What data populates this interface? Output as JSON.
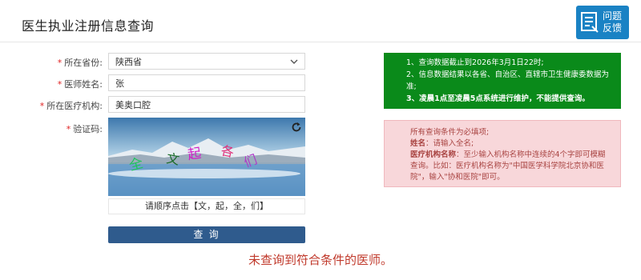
{
  "page": {
    "title": "医生执业注册信息查询"
  },
  "feedback": {
    "line1": "问题",
    "line2": "反馈"
  },
  "form": {
    "province": {
      "label": "所在省份:",
      "value": "陕西省"
    },
    "name": {
      "label": "医师姓名:",
      "value": "张"
    },
    "institution": {
      "label": "所在医疗机构:",
      "value": "美奥口腔"
    },
    "captcha": {
      "label": "验证码:",
      "chars": [
        "全",
        "文",
        "起",
        "各",
        "们"
      ],
      "hint": "请顺序点击【文，起，全，们】"
    },
    "submit": "查 询"
  },
  "notice_green": [
    "1、查询数据截止到2026年3月1日22时;",
    "2、信息数据结果以各省、自治区、直辖市卫生健康委数据为准;",
    "3、凌晨1点至凌晨5点系统进行维护，不能提供查询。"
  ],
  "notice_red": {
    "line1": "所有查询条件为必填项;",
    "name_label": "姓名",
    "name_text": "：请输入全名;",
    "inst_label": "医疗机构名称",
    "inst_text": "：至少输入机构名称中连续的4个字即可模糊查询。比如：医疗机构名称为\"中国医学科学院北京协和医院\"，输入\"协和医院\"即可。"
  },
  "result": "未查询到符合条件的医师。",
  "colors": {
    "accent_blue": "#2f5b8d",
    "notice_green": "#0a8a1a",
    "notice_red_bg": "#f8d7da",
    "result_text": "#c0392b",
    "required": "#e02020"
  }
}
